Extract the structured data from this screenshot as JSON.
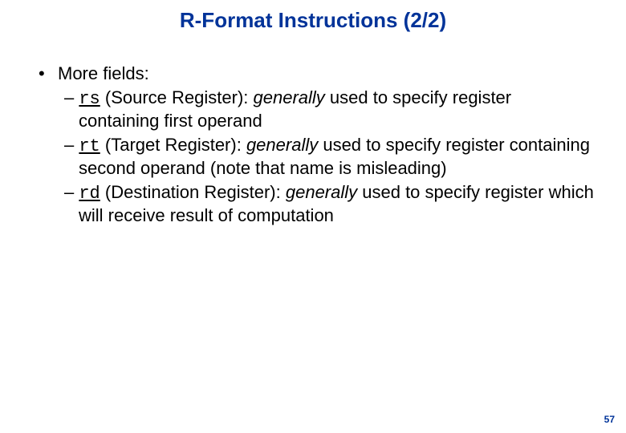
{
  "title": "R-Format Instructions (2/2)",
  "bullet1": "More fields:",
  "fields": {
    "rs": {
      "code": "rs",
      "label_open": " (Source Register): ",
      "generally": "generally",
      "rest": " used to specify register containing first operand"
    },
    "rt": {
      "code": "rt",
      "label_open": " (Target Register): ",
      "generally": "generally",
      "rest": " used to specify register containing second operand (note that name is misleading)"
    },
    "rd": {
      "code": "rd",
      "label_open": " (Destination Register): ",
      "generally": "generally",
      "rest": " used to specify register which will receive result of computation"
    }
  },
  "page_number": "57"
}
